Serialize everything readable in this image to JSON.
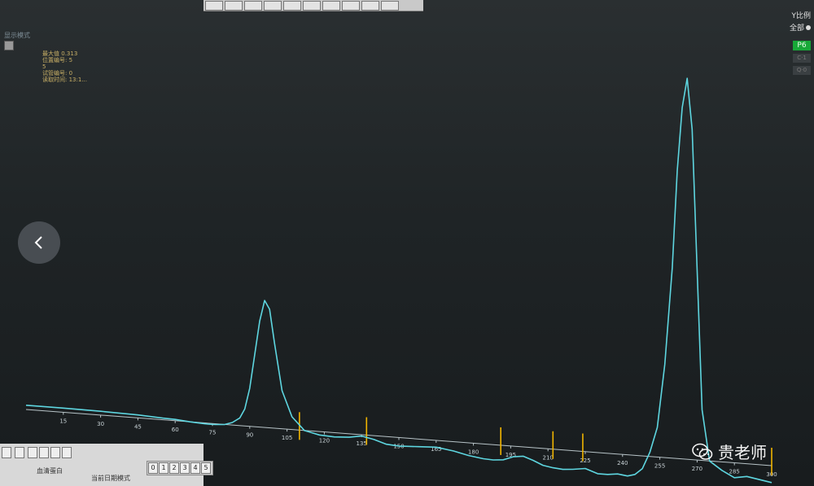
{
  "toolbar": {
    "buttons": [
      "tool-1",
      "tool-2",
      "tool-3",
      "tool-4",
      "tool-5",
      "tool-6",
      "tool-7",
      "tool-8",
      "tool-9",
      "tool-10"
    ]
  },
  "window": {
    "title": "显示模式"
  },
  "info": {
    "max_label": "最大值",
    "max_value": "0.313",
    "position_label": "位置编号",
    "position_value": "5",
    "row3_value": "5",
    "tube_label": "试管编号",
    "tube_value": "0",
    "read_time_label": "读取时间",
    "read_time_value": "13:1..."
  },
  "y_scale": {
    "label": "Y比例",
    "all_label": "全部"
  },
  "side_buttons": {
    "p6": "P6",
    "b2": "C·1",
    "b3": "Q·0"
  },
  "bottom_bar": {
    "label1": "血清蛋白",
    "label2": "当前日期模式"
  },
  "page_tabs": [
    "0",
    "1",
    "2",
    "3",
    "4",
    "5"
  ],
  "watermark": {
    "text": "贵老师",
    "icon": "wechat-icon"
  },
  "colors": {
    "trace": "#5ed6e0",
    "marker": "#f0b400",
    "p6": "#18a838"
  },
  "chart_data": {
    "type": "line",
    "x_ticks": [
      15,
      30,
      45,
      60,
      75,
      90,
      105,
      120,
      135,
      150,
      165,
      180,
      195,
      210,
      225,
      240,
      255,
      270,
      285,
      300
    ],
    "xlim": [
      0,
      300
    ],
    "series": [
      {
        "x": [
          0,
          15,
          30,
          45,
          55,
          60,
          66,
          72,
          76,
          80,
          83,
          86,
          88,
          90,
          92,
          94,
          96,
          98,
          100,
          103,
          107,
          112,
          118,
          124,
          130,
          135,
          140,
          145,
          150,
          158,
          165,
          172,
          178,
          184,
          188,
          192,
          196,
          200,
          204,
          208,
          212,
          216,
          220,
          225,
          230,
          234,
          238,
          242,
          245,
          248,
          251,
          254,
          257,
          260,
          262,
          264,
          266,
          268,
          270,
          272,
          275,
          280,
          285,
          290,
          300
        ],
        "y": [
          0.01,
          0.01,
          0.009,
          0.007,
          0.004,
          0.003,
          0.0,
          -0.002,
          -0.002,
          0.0,
          0.006,
          0.018,
          0.04,
          0.09,
          0.17,
          0.25,
          0.3,
          0.28,
          0.2,
          0.09,
          0.03,
          0.0,
          -0.008,
          -0.01,
          -0.008,
          -0.003,
          -0.009,
          -0.018,
          -0.02,
          -0.018,
          -0.016,
          -0.022,
          -0.03,
          -0.035,
          -0.036,
          -0.034,
          -0.025,
          -0.022,
          -0.03,
          -0.04,
          -0.044,
          -0.046,
          -0.044,
          -0.04,
          -0.05,
          -0.05,
          -0.047,
          -0.05,
          -0.045,
          -0.03,
          0.01,
          0.07,
          0.22,
          0.45,
          0.68,
          0.83,
          0.9,
          0.78,
          0.45,
          0.12,
          0.0,
          -0.02,
          -0.035,
          -0.03,
          -0.04
        ]
      }
    ],
    "markers": [
      110,
      137,
      191,
      212,
      224,
      300
    ]
  }
}
